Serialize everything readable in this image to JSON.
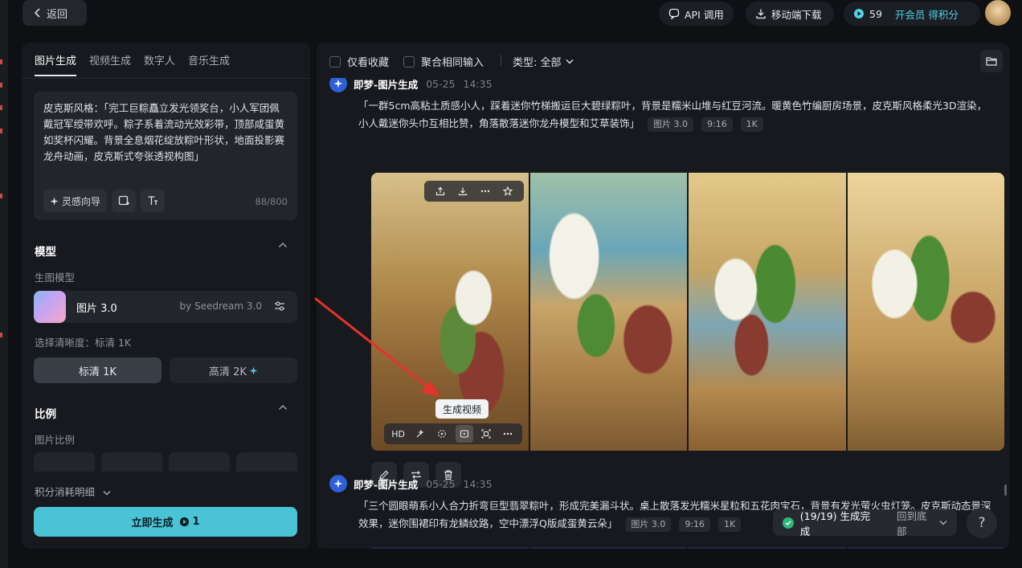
{
  "topbar": {
    "back_label": "返回",
    "api_label": "API 调用",
    "mobile_label": "移动端下载",
    "credits": "59",
    "member_label": "开会员 得积分"
  },
  "left": {
    "tabs": [
      "图片生成",
      "视频生成",
      "数字人",
      "音乐生成"
    ],
    "prompt": "皮克斯风格：「完工巨粽矗立发光领奖台，小人军团佩戴冠军绶带欢呼。粽子系着流动光效彩带，顶部咸蛋黄如奖杯闪耀。背景全息烟花绽放粽叶形状，地面投影赛龙舟动画，皮克斯式夸张透视构图」",
    "inspiration_label": "灵感向导",
    "char_count": "88/800",
    "model_section": "模型",
    "model_sub": "生图模型",
    "model_name": "图片 3.0",
    "model_by": "by Seedream 3.0",
    "resolution_label": "选择清晰度：标清 1K",
    "res_sd": "标清 1K",
    "res_hd": "高清 2K",
    "ratio_section": "比例",
    "ratio_sub": "图片比例",
    "credit_detail": "积分消耗明细",
    "generate_label": "立即生成",
    "generate_cost": "1"
  },
  "right": {
    "filter_fav": "仅看收藏",
    "filter_group": "聚合相同输入",
    "type_filter": "类型: 全部",
    "items": [
      {
        "source": "即梦-图片生成",
        "date": "05-25",
        "time": "14:35",
        "prompt": "「一群5cm高粘土质感小人，踩着迷你竹梯搬运巨大碧绿粽叶，背景是糯米山堆与红豆河流。暖黄色竹编厨房场景，皮克斯风格柔光3D渲染，小人戴迷你头巾互相比赞，角落散落迷你龙舟模型和艾草装饰」",
        "tags": [
          "图片 3.0",
          "9:16",
          "1K"
        ]
      },
      {
        "source": "即梦-图片生成",
        "date": "05-25",
        "time": "14:35",
        "prompt": "「三个圆眼萌系小人合力折弯巨型翡翠粽叶，形成完美漏斗状。桌上散落发光糯米星粒和五花肉宝石，背景有发光萤火虫灯笼。皮克斯动态景深效果，迷你围裙印有龙鳞纹路，空中漂浮Q版咸蛋黄云朵」",
        "tags": [
          "图片 3.0",
          "9:16",
          "1K"
        ]
      }
    ],
    "hover_hd": "HD",
    "tooltip": "生成视频"
  },
  "toast": {
    "message": "(19/19) 生成完成",
    "back_bottom": "回到底部"
  },
  "help": "?",
  "colors": {
    "accent": "#4bc3d6",
    "success": "#2fb87a",
    "annotation_arrow": "#e5322d"
  }
}
